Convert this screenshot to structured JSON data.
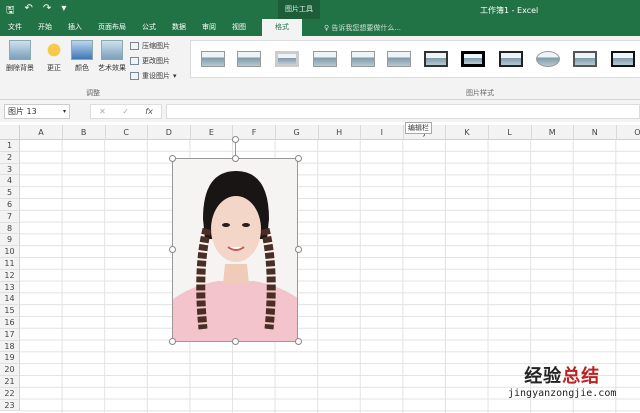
{
  "window": {
    "title": "工作簿1 - Excel",
    "context_tab_group": "图片工具",
    "tell_me": "告诉我您想要做什么..."
  },
  "qat": {
    "save": "🖫",
    "undo": "↶",
    "redo": "↷",
    "more": "▾"
  },
  "tabs": [
    "文件",
    "开始",
    "插入",
    "页面布局",
    "公式",
    "数据",
    "审阅",
    "视图"
  ],
  "active_tab": "格式",
  "ribbon": {
    "adjust": {
      "remove_bg": "删除背景",
      "corrections": "更正",
      "color": "颜色",
      "artistic": "艺术效果",
      "compress": "压缩图片",
      "change": "更改图片",
      "reset": "重设图片",
      "group_label": "调整"
    },
    "styles": {
      "group_label": "图片样式",
      "count": 11
    }
  },
  "formula_bar": {
    "name_box": "图片 13",
    "cancel": "✕",
    "enter": "✓",
    "fx": "fx",
    "value": ""
  },
  "columns": [
    "A",
    "B",
    "C",
    "D",
    "E",
    "F",
    "G",
    "H",
    "I",
    "J",
    "K",
    "L",
    "M",
    "N",
    "O"
  ],
  "rows": [
    "1",
    "2",
    "3",
    "4",
    "5",
    "6",
    "7",
    "8",
    "9",
    "10",
    "11",
    "12",
    "13",
    "14",
    "15",
    "16",
    "17",
    "18",
    "19",
    "20",
    "21",
    "22",
    "23"
  ],
  "tooltip": "编辑栏",
  "watermark": {
    "text_dark": "经验",
    "text_red": "总结",
    "url": "jingyanzongjie.com"
  }
}
